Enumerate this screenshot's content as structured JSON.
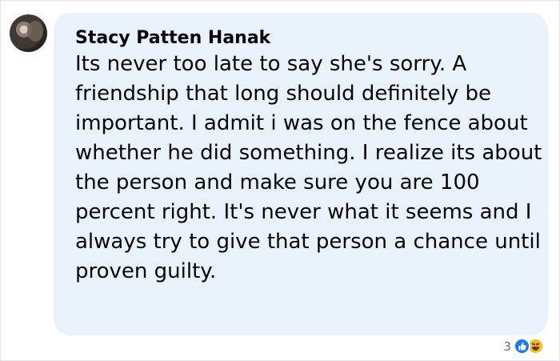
{
  "comment": {
    "author": "Stacy Patten Hanak",
    "text": "Its never too late to say she's sorry. A friendship that long should definitely be important. I admit i was on the fence about whether he did something. I realize its about the person and make sure you are 100 percent right. It's never what it seems and I always try to give that person a chance until proven guilty."
  },
  "reactions": {
    "count": "3",
    "icons": [
      "like-icon",
      "haha-icon"
    ]
  },
  "colors": {
    "bubble": "#e9f1fb",
    "like": "#1877f2",
    "haha": "#f7b928"
  }
}
